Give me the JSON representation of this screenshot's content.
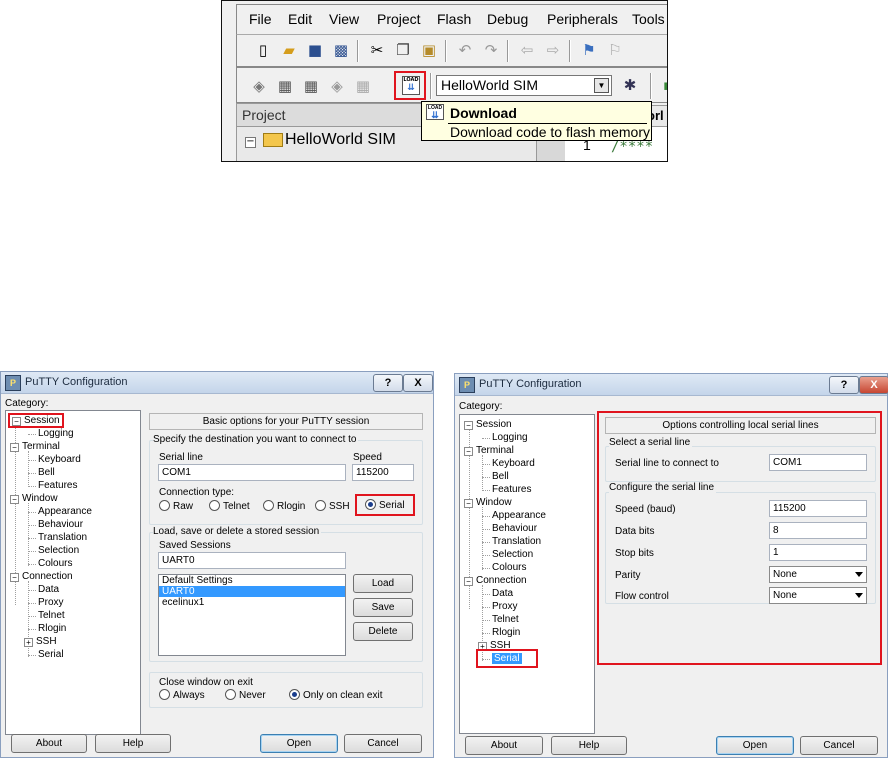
{
  "ide": {
    "menu": [
      "File",
      "Edit",
      "View",
      "Project",
      "Flash",
      "Debug",
      "Peripherals",
      "Tools"
    ],
    "load_icon_text": "LOAD",
    "target": "HelloWorld SIM",
    "project_header": "Project",
    "project_tree_item": "HelloWorld SIM",
    "tab_fragment": "orl",
    "editor_line_no": "1",
    "editor_comment": "/****",
    "tooltip_title": "Download",
    "tooltip_desc": "Download code to flash memory"
  },
  "putty_common": {
    "title": "PuTTY Configuration",
    "help_glyph": "?",
    "close_glyph": "X",
    "category_label": "Category:",
    "tree": [
      "Session",
      "Logging",
      "Terminal",
      "Keyboard",
      "Bell",
      "Features",
      "Window",
      "Appearance",
      "Behaviour",
      "Translation",
      "Selection",
      "Colours",
      "Connection",
      "Data",
      "Proxy",
      "Telnet",
      "Rlogin",
      "SSH",
      "Serial"
    ],
    "expander_open": "−",
    "expander_closed": "+",
    "about_label": "About",
    "help_label": "Help",
    "open_label": "Open",
    "cancel_label": "Cancel"
  },
  "session": {
    "header": "Basic options for your PuTTY session",
    "dest_group": "Specify the destination you want to connect to",
    "serial_line_label": "Serial line",
    "serial_line_value": "COM1",
    "speed_label": "Speed",
    "speed_value": "115200",
    "conn_type_label": "Connection type:",
    "conn_types": [
      "Raw",
      "Telnet",
      "Rlogin",
      "SSH",
      "Serial"
    ],
    "selected_conn_type": "Serial",
    "stored_group": "Load, save or delete a stored session",
    "saved_sessions_label": "Saved Sessions",
    "saved_session_value": "UART0",
    "session_list": [
      "Default Settings",
      "UART0",
      "ecelinux1"
    ],
    "selected_session": "UART0",
    "load_label": "Load",
    "save_label": "Save",
    "delete_label": "Delete",
    "close_group": "Close window on exit",
    "close_options": [
      "Always",
      "Never",
      "Only on clean exit"
    ],
    "selected_close": "Only on clean exit"
  },
  "serial": {
    "header": "Options controlling local serial lines",
    "select_group": "Select a serial line",
    "line_label": "Serial line to connect to",
    "line_value": "COM1",
    "config_group": "Configure the serial line",
    "speed_label": "Speed (baud)",
    "speed_value": "115200",
    "databits_label": "Data bits",
    "databits_value": "8",
    "stopbits_label": "Stop bits",
    "stopbits_value": "1",
    "parity_label": "Parity",
    "parity_value": "None",
    "flow_label": "Flow control",
    "flow_value": "None"
  }
}
